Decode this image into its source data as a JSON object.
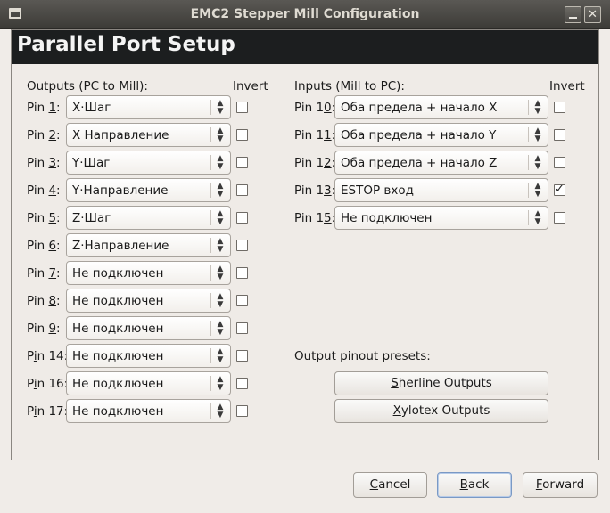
{
  "window": {
    "title": "EMC2 Stepper Mill Configuration",
    "close_glyph": "✕"
  },
  "page": {
    "title": "Parallel Port Setup"
  },
  "outputs": {
    "label": "Outputs (PC to Mill):",
    "invert_label": "Invert",
    "pins": [
      {
        "prefix": "Pin ",
        "num": "1",
        "value": "X·Шаг",
        "invert": false
      },
      {
        "prefix": "Pin ",
        "num": "2",
        "value": "X Направление",
        "invert": false
      },
      {
        "prefix": "Pin ",
        "num": "3",
        "value": "Y·Шаг",
        "invert": false
      },
      {
        "prefix": "Pin ",
        "num": "4",
        "value": "Y·Направление",
        "invert": false
      },
      {
        "prefix": "Pin ",
        "num": "5",
        "value": "Z·Шаг",
        "invert": false
      },
      {
        "prefix": "Pin ",
        "num": "6",
        "value": "Z·Направление",
        "invert": false
      },
      {
        "prefix": "Pin ",
        "num": "7",
        "value": "Не подключен",
        "invert": false
      },
      {
        "prefix": "Pin ",
        "num": "8",
        "value": "Не подключен",
        "invert": false
      },
      {
        "prefix": "Pin ",
        "num": "9",
        "value": "Не подключен",
        "invert": false
      },
      {
        "prefix": "P",
        "mn": "i",
        "rest": "n 14:",
        "value": "Не подключен",
        "invert": false
      },
      {
        "prefix": "P",
        "mn": "i",
        "rest": "n 16:",
        "value": "Не подключен",
        "invert": false
      },
      {
        "prefix": "P",
        "mn": "i",
        "rest": "n 17:",
        "value": "Не подключен",
        "invert": false
      }
    ]
  },
  "inputs": {
    "label": "Inputs (Mill to PC):",
    "invert_label": "Invert",
    "pins": [
      {
        "pre": "Pin 1",
        "mn": "0",
        "post": ":",
        "value": "Оба предела + начало X",
        "invert": false
      },
      {
        "pre": "Pin 1",
        "mn": "1",
        "post": ":",
        "value": "Оба предела + начало Y",
        "invert": false
      },
      {
        "pre": "Pin 1",
        "mn": "2",
        "post": ":",
        "value": "Оба предела + начало Z",
        "invert": false
      },
      {
        "pre": "Pin 1",
        "mn": "3",
        "post": ":",
        "value": "ESTOP вход",
        "invert": true
      },
      {
        "pre": "Pin 1",
        "mn": "5",
        "post": ":",
        "value": "Не подключен",
        "invert": false
      }
    ]
  },
  "presets": {
    "label": "Output pinout presets:",
    "sherline": {
      "mn": "S",
      "rest": "herline Outputs"
    },
    "xylotex": {
      "mn": "X",
      "rest": "ylotex Outputs"
    }
  },
  "nav": {
    "cancel": {
      "mn": "C",
      "rest": "ancel"
    },
    "back": {
      "mn": "B",
      "rest": "ack"
    },
    "forward": {
      "mn": "F",
      "rest": "orward"
    }
  },
  "icons": {
    "window_menu": "window-menu-icon",
    "minimize": "minimize-icon",
    "close": "close-icon",
    "combo_arrow": "updown-arrows-icon",
    "checkmark": "checkmark-icon"
  },
  "colors": {
    "titlebar": "#3c3b37",
    "header": "#1c1e1f",
    "background": "#efebe7",
    "focus": "#7a99c5"
  }
}
